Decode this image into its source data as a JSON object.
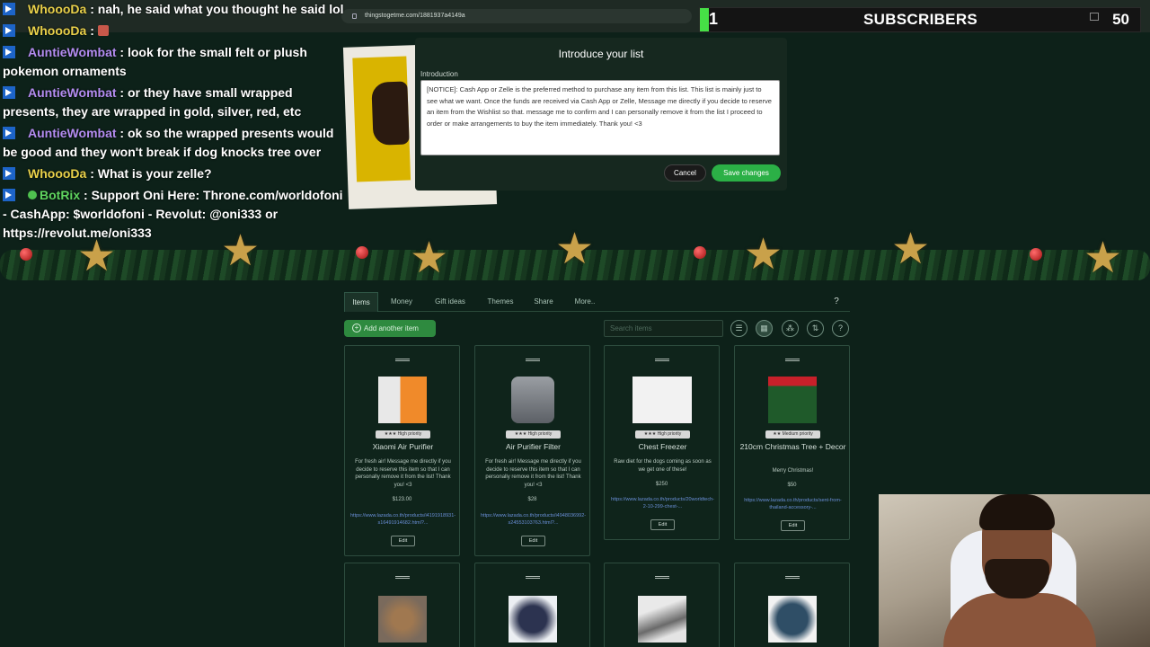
{
  "browser": {
    "url": "thingstogetme.com/1881937a4149a"
  },
  "subscribers": {
    "count": "1",
    "label": "SUBSCRIBERS",
    "goal": "50",
    "progress": 0.02,
    "accent_color": "#46e046"
  },
  "chat": [
    {
      "user": "WhoooDa",
      "text": ": nah, he said what you thought he said lol",
      "color": "#e8d04a"
    },
    {
      "user": "WhoooDa",
      "text": ": ",
      "color": "#e8d04a"
    },
    {
      "user": "AuntieWombat",
      "text": ": look for the small felt or plush pokemon ornaments",
      "color": "#b38cf0"
    },
    {
      "user": "AuntieWombat",
      "text": ": or they have small wrapped presents, they are wrapped in gold, silver, red, etc",
      "color": "#b38cf0"
    },
    {
      "user": "AuntieWombat",
      "text": ": ok so the wrapped presents would be good and they won't break if dog knocks tree over",
      "color": "#b38cf0"
    },
    {
      "user": "WhoooDa",
      "text": ": What is your zelle?",
      "color": "#e8d04a"
    },
    {
      "user": "BotRix",
      "text": ": Support Oni Here: Throne.com/worldofoni - CashApp: $worldofoni - Revolut: @oni333 or https://revolut.me/oni333",
      "color": "#5fd45f"
    }
  ],
  "modal": {
    "title": "Introduce your list",
    "field_label": "Introduction",
    "text": "[NOTICE]: Cash App or Zelle is the preferred method to purchase any item from this list. This list is mainly just to see what we want.  Once the funds are received via Cash App or Zelle, Message me directly if you decide to reserve an item from the Wishlist so that. message me to confirm and I can personally remove it from the list I proceed to order or make arrangements to buy the item immediately. Thank you! <3",
    "cancel_label": "Cancel",
    "save_label": "Save changes",
    "save_color": "#2bb046"
  },
  "tabs": {
    "items": [
      "Items",
      "Money",
      "Gift ideas",
      "Themes",
      "Share",
      "More.."
    ],
    "help": "?"
  },
  "toolbar": {
    "add_label": "Add another item",
    "search_placeholder": "Search items",
    "icons": [
      "list-view-icon",
      "grid-view-icon",
      "category-icon",
      "sort-icon",
      "help-icon"
    ]
  },
  "items": [
    {
      "name": "Xiaomi Air Purifier",
      "priority": "★★★ High priority",
      "desc": "For fresh air! Message me directly if you decide to reserve this item so that I can personally remove it from the list! Thank you! <3",
      "price": "$123.00",
      "link": "https://www.lazada.co.th/products/i4191918931-s16491914682.html?...",
      "edit": "Edit"
    },
    {
      "name": "Air Purifier Filter",
      "priority": "★★★ High priority",
      "desc": "For fresh air! Message me directly if you decide to reserve this item so that I can personally remove it from the list! Thank you! <3",
      "price": "$28",
      "link": "https://www.lazada.co.th/products/i4948036992-s24553103763.html?...",
      "edit": "Edit"
    },
    {
      "name": "Chest Freezer",
      "priority": "★★★ High priority",
      "desc": "Raw diet for the dogs coming as soon as we get one of these!",
      "price": "$250",
      "link": "https://www.lazada.co.th/products/20worldtech-2-10-299-chest-...",
      "edit": "Edit"
    },
    {
      "name": "210cm Christmas Tree + Decor",
      "priority": "★★ Medium priority",
      "desc": "Merry Christmas!",
      "price": "$50",
      "link": "https://www.lazada.co.th/products/sent-from-thailand-accessory-...",
      "edit": "Edit"
    }
  ]
}
